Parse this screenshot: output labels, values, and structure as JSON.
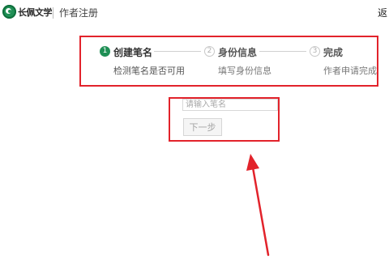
{
  "header": {
    "logo_text": "长佩文学",
    "title": "作者注册",
    "back_label": "返"
  },
  "steps": [
    {
      "number": "1",
      "title": "创建笔名",
      "description": "检测笔名是否可用",
      "state": "active"
    },
    {
      "number": "2",
      "title": "身份信息",
      "description": "填写身份信息",
      "state": "inactive"
    },
    {
      "number": "3",
      "title": "完成",
      "description": "作者申请完成",
      "state": "inactive"
    }
  ],
  "form": {
    "pen_name_placeholder": "请输入笔名",
    "next_button_label": "下一步"
  },
  "colors": {
    "accent_green": "#1f8f55",
    "annotation_red": "#e2232b"
  },
  "icons": {
    "logo": "changpei-logo-icon",
    "step_active": "step-number-filled-icon",
    "step_inactive": "step-number-outline-icon",
    "annotation": "red-arrow-annotation"
  }
}
